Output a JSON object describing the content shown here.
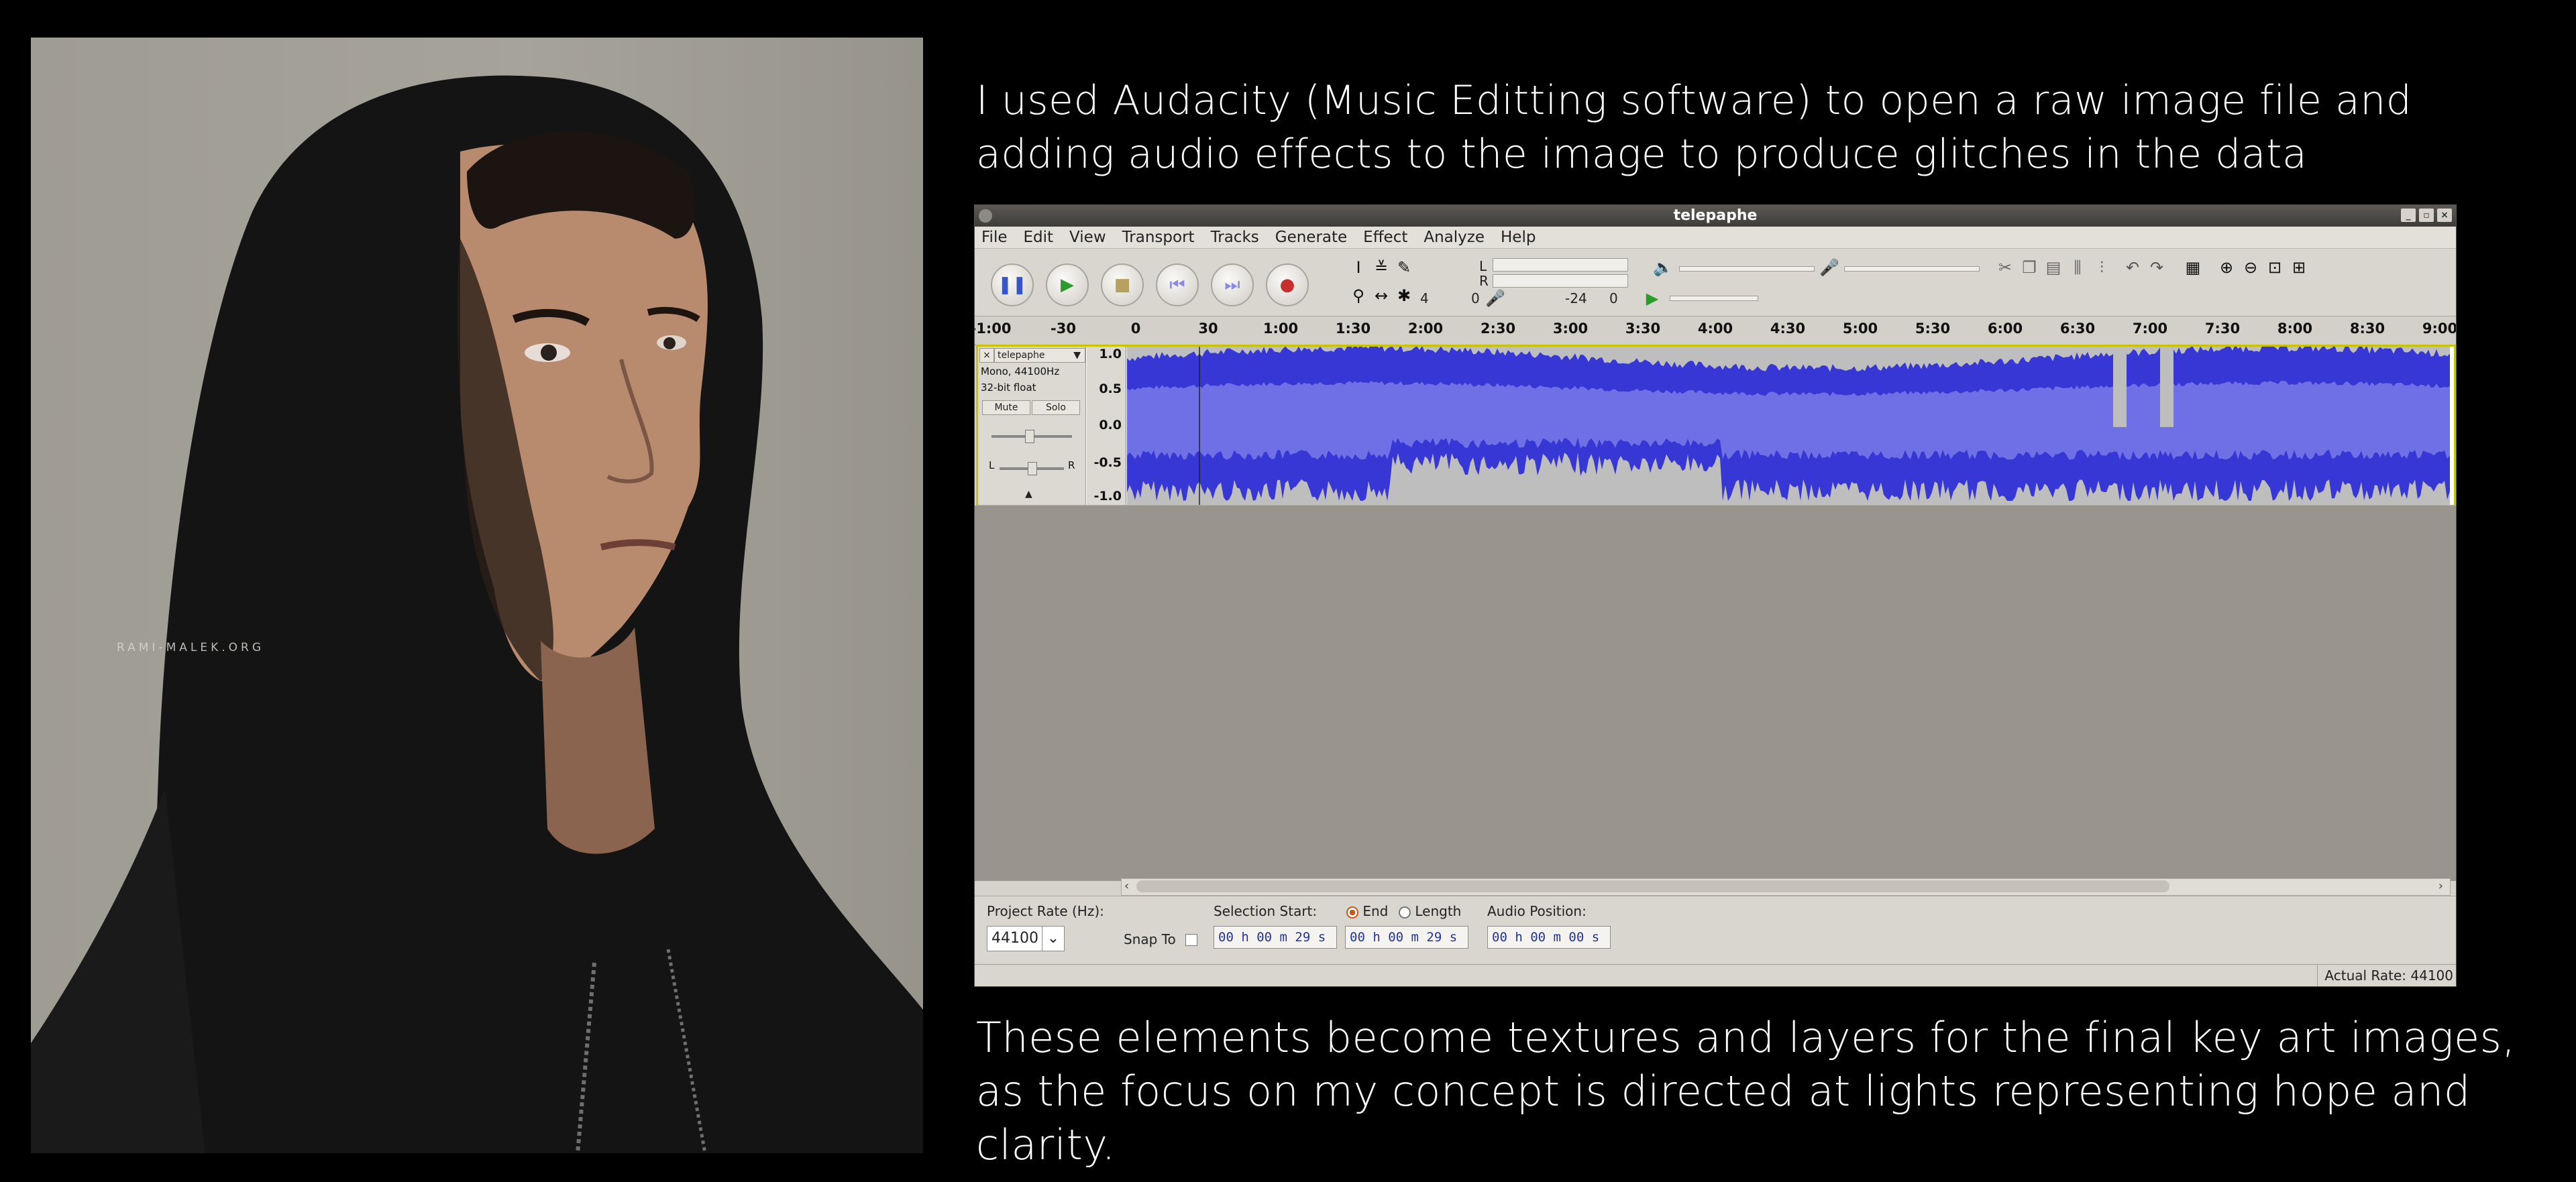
{
  "photo": {
    "watermark": "RAMI-MALEK.ORG"
  },
  "captions": {
    "top_line1": "I used Audacity (Music Editting software) to open a raw image file and",
    "top_line2": "adding audio effects to the image to produce glitches in the data",
    "bottom_line1": "These elements become textures and layers for the final key art images,",
    "bottom_line2": "as the focus on my concept is directed at lights representing hope and clarity."
  },
  "audacity": {
    "window_title": "telepaphe",
    "menu": [
      "File",
      "Edit",
      "View",
      "Transport",
      "Tracks",
      "Generate",
      "Effect",
      "Analyze",
      "Help"
    ],
    "meters": {
      "left": "L",
      "right": "R",
      "db_a": "4",
      "db_b": "0",
      "db_c": "-24",
      "db_d": "0"
    },
    "ruler_ticks": [
      "-1:00",
      "-30",
      "0",
      "30",
      "1:00",
      "1:30",
      "2:00",
      "2:30",
      "3:00",
      "3:30",
      "4:00",
      "4:30",
      "5:00",
      "5:30",
      "6:00",
      "6:30",
      "7:00",
      "7:30",
      "8:00",
      "8:30",
      "9:00"
    ],
    "track": {
      "name": "telepaphe",
      "info1": "Mono, 44100Hz",
      "info2": "32-bit float",
      "mute": "Mute",
      "solo": "Solo",
      "pan_left": "L",
      "pan_right": "R",
      "scale": [
        "1.0",
        "0.5",
        "0.0",
        "-0.5",
        "-1.0"
      ]
    },
    "selection_toolbar": {
      "project_rate_label": "Project Rate (Hz):",
      "project_rate_value": "44100",
      "snap_to": "Snap To",
      "selection_start_label": "Selection Start:",
      "end_label": "End",
      "length_label": "Length",
      "audio_position_label": "Audio Position:",
      "start_time": "00 h 00 m 29 s",
      "end_time": "00 h 00 m 29 s",
      "audio_position": "00 h 00 m 00 s"
    },
    "status": {
      "actual_rate": "Actual Rate: 44100"
    },
    "colors": {
      "wave_dark": "#3737d6",
      "wave_light": "#6f6fe6",
      "wave_bg": "#bebebe",
      "track_border": "#c9c400"
    }
  }
}
